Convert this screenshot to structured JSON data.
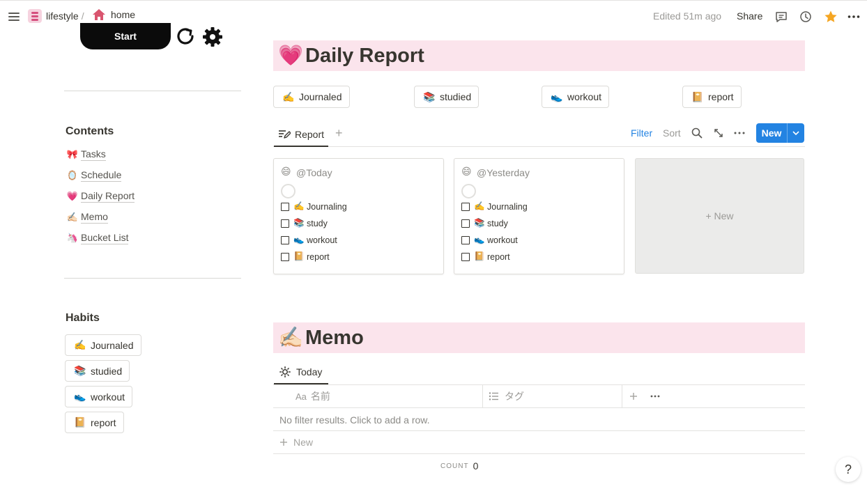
{
  "topbar": {
    "crumb_workspace": "lifestyle",
    "crumb_separator": "/",
    "crumb_page": "home",
    "edited": "Edited 51m ago",
    "share": "Share",
    "icons": [
      "menu-icon",
      "comment-icon",
      "history-icon",
      "star-icon",
      "more-icon"
    ]
  },
  "left": {
    "start_label": "Start",
    "contents_heading": "Contents",
    "contents": [
      {
        "emoji": "🎀",
        "label": "Tasks"
      },
      {
        "emoji": "🪞",
        "label": "Schedule"
      },
      {
        "emoji": "💗",
        "label": "Daily Report"
      },
      {
        "emoji": "✍🏻",
        "label": "Memo"
      },
      {
        "emoji": "🦄",
        "label": "Bucket List"
      }
    ],
    "habits_heading": "Habits",
    "habits": [
      {
        "emoji": "✍️",
        "label": "Journaled"
      },
      {
        "emoji": "📚",
        "label": "studied"
      },
      {
        "emoji": "👟",
        "label": "workout"
      },
      {
        "emoji": "📔",
        "label": "report"
      }
    ]
  },
  "daily_report": {
    "emoji": "💗",
    "title": "Daily Report",
    "chips": [
      {
        "emoji": "✍️",
        "label": "Journaled"
      },
      {
        "emoji": "📚",
        "label": "studied"
      },
      {
        "emoji": "👟",
        "label": "workout"
      },
      {
        "emoji": "📔",
        "label": "report"
      }
    ],
    "view_tab": "Report",
    "add_view": "+",
    "filter": "Filter",
    "sort": "Sort",
    "new_button": "New",
    "cards": [
      {
        "emoji": "😄",
        "title": "@Today",
        "tasks": [
          {
            "emoji": "✍️",
            "label": "Journaling"
          },
          {
            "emoji": "📚",
            "label": "study"
          },
          {
            "emoji": "👟",
            "label": "workout"
          },
          {
            "emoji": "📔",
            "label": "report"
          }
        ]
      },
      {
        "emoji": "😄",
        "title": "@Yesterday",
        "tasks": [
          {
            "emoji": "✍️",
            "label": "Journaling"
          },
          {
            "emoji": "📚",
            "label": "study"
          },
          {
            "emoji": "👟",
            "label": "workout"
          },
          {
            "emoji": "📔",
            "label": "report"
          }
        ]
      }
    ],
    "new_card": "+ New"
  },
  "memo": {
    "emoji": "✍🏻",
    "title": "Memo",
    "view_tab": "Today",
    "columns": [
      {
        "icon": "Aa",
        "label": "名前"
      },
      {
        "icon": "list-icon",
        "label": "タグ"
      }
    ],
    "empty_message": "No filter results. Click to add a row.",
    "new_row": "New",
    "count_label": "COUNT",
    "count_value": "0"
  },
  "help": "?",
  "colors": {
    "accent": "#2383e2",
    "header_bg": "#fbe4ec",
    "star": "#f5a623"
  }
}
